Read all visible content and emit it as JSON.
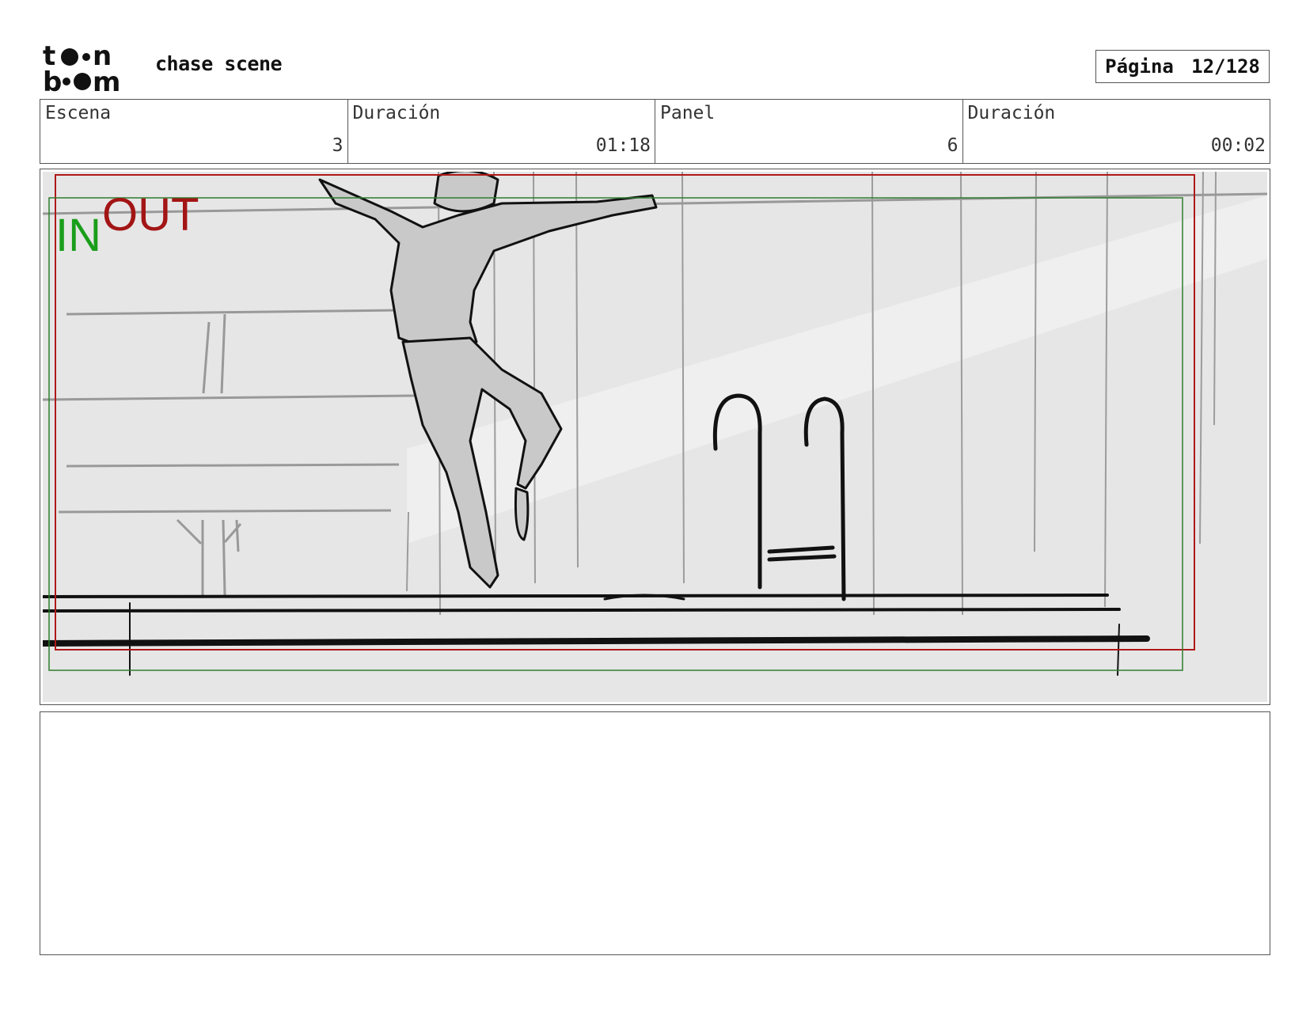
{
  "header": {
    "project_title": "chase scene",
    "page_label": "Página",
    "page_value": "12/128"
  },
  "info_fields": [
    {
      "label": "Escena",
      "value": "3"
    },
    {
      "label": "Duración",
      "value": "01:18"
    },
    {
      "label": "Panel",
      "value": "6"
    },
    {
      "label": "Duración",
      "value": "00:02"
    }
  ],
  "panel": {
    "in_marker": "IN",
    "out_marker": "OUT",
    "colors": {
      "in": "#1a9e1a",
      "out": "#a31515",
      "background": "#e6e6e6"
    }
  },
  "notes": {
    "text": ""
  },
  "logo": {
    "name": "toon-boom-logo"
  }
}
